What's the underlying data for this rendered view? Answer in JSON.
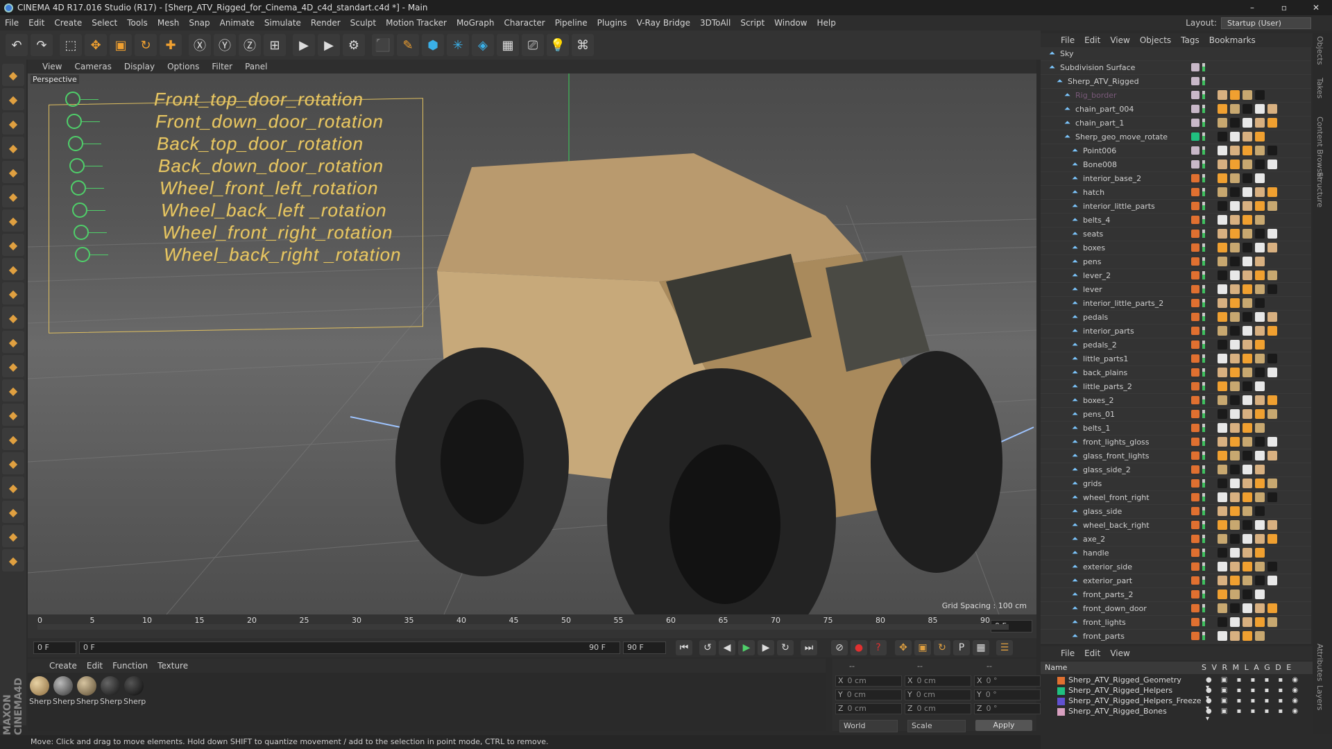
{
  "window": {
    "title": "CINEMA 4D R17.016 Studio (R17) - [Sherp_ATV_Rigged_for_Cinema_4D_c4d_standart.c4d *] - Main",
    "minimize": "–",
    "maximize": "▫",
    "close": "✕"
  },
  "menubar": [
    "File",
    "Edit",
    "Create",
    "Select",
    "Tools",
    "Mesh",
    "Snap",
    "Animate",
    "Simulate",
    "Render",
    "Sculpt",
    "Motion Tracker",
    "MoGraph",
    "Character",
    "Pipeline",
    "Plugins",
    "V-Ray Bridge",
    "3DToAll",
    "Script",
    "Window",
    "Help"
  ],
  "layout": {
    "label": "Layout:",
    "value": "Startup (User)"
  },
  "toolbar_icons": [
    "undo-icon",
    "redo-icon",
    "select-icon",
    "move-icon",
    "scale-icon",
    "rotate-icon",
    "live-select-icon",
    "x-axis-icon",
    "y-axis-icon",
    "z-axis-icon",
    "coord-system-icon",
    "render-view-icon",
    "render-picture-viewer-icon",
    "render-settings-icon",
    "cube-icon",
    "pen-icon",
    "subdivision-icon",
    "array-icon",
    "deformer-icon",
    "floor-icon",
    "camera-icon",
    "light-icon",
    "python-icon"
  ],
  "viewport": {
    "menu": [
      "View",
      "Cameras",
      "Display",
      "Options",
      "Filter",
      "Panel"
    ],
    "label": "Perspective",
    "grid_spacing": "Grid Spacing : 100 cm",
    "rig_controls": [
      "Front_top_door_rotation",
      "Front_down_door_rotation",
      "Back_top_door_rotation",
      "Back_down_door_rotation",
      "Wheel_front_left_rotation",
      "Wheel_back_left _rotation",
      "Wheel_front_right_rotation",
      "Wheel_back_right _rotation"
    ]
  },
  "timeline": {
    "ticks": [
      "0",
      "5",
      "10",
      "15",
      "20",
      "25",
      "30",
      "35",
      "40",
      "45",
      "50",
      "55",
      "60",
      "65",
      "70",
      "75",
      "80",
      "85",
      "90"
    ],
    "current_frame_end": "0 F",
    "start_field": "0 F",
    "range_start": "0 F",
    "range_end": "90 F",
    "end_field": "90 F"
  },
  "materials": {
    "menu": [
      "Create",
      "Edit",
      "Function",
      "Texture"
    ],
    "items": [
      "Sherp",
      "Sherp",
      "Sherp",
      "Sherp",
      "Sherp"
    ]
  },
  "coordinates": {
    "header_left": "--",
    "header_mid": "--",
    "header_right": "--",
    "rows": [
      {
        "a": "X",
        "av": "0 cm",
        "b": "X",
        "bv": "0 cm",
        "c": "X",
        "cv": "0 °"
      },
      {
        "a": "Y",
        "av": "0 cm",
        "b": "Y",
        "bv": "0 cm",
        "c": "Y",
        "cv": "0 °"
      },
      {
        "a": "Z",
        "av": "0 cm",
        "b": "Z",
        "bv": "0 cm",
        "c": "Z",
        "cv": "0 °"
      }
    ],
    "mode1": "World",
    "mode2": "Scale",
    "apply": "Apply"
  },
  "status": "Move: Click and drag to move elements. Hold down SHIFT to quantize movement / add to the selection in point mode, CTRL to remove.",
  "objects": {
    "menu": [
      "File",
      "Edit",
      "View",
      "Objects",
      "Tags",
      "Bookmarks"
    ],
    "items": [
      {
        "name": "Sky",
        "indent": 0
      },
      {
        "name": "Subdivision Surface",
        "indent": 0
      },
      {
        "name": "Sherp_ATV_Rigged",
        "indent": 1
      },
      {
        "name": "Rig_border",
        "indent": 2
      },
      {
        "name": "chain_part_004",
        "indent": 2
      },
      {
        "name": "chain_part_1",
        "indent": 2
      },
      {
        "name": "Sherp_geo_move_rotate",
        "indent": 2
      },
      {
        "name": "Point006",
        "indent": 3
      },
      {
        "name": "Bone008",
        "indent": 3
      },
      {
        "name": "interior_base_2",
        "indent": 3
      },
      {
        "name": "hatch",
        "indent": 3
      },
      {
        "name": "interior_little_parts",
        "indent": 3
      },
      {
        "name": "belts_4",
        "indent": 3
      },
      {
        "name": "seats",
        "indent": 3
      },
      {
        "name": "boxes",
        "indent": 3
      },
      {
        "name": "pens",
        "indent": 3
      },
      {
        "name": "lever_2",
        "indent": 3
      },
      {
        "name": "lever",
        "indent": 3
      },
      {
        "name": "interior_little_parts_2",
        "indent": 3
      },
      {
        "name": "pedals",
        "indent": 3
      },
      {
        "name": "interior_parts",
        "indent": 3
      },
      {
        "name": "pedals_2",
        "indent": 3
      },
      {
        "name": "little_parts1",
        "indent": 3
      },
      {
        "name": "back_plains",
        "indent": 3
      },
      {
        "name": "little_parts_2",
        "indent": 3
      },
      {
        "name": "boxes_2",
        "indent": 3
      },
      {
        "name": "pens_01",
        "indent": 3
      },
      {
        "name": "belts_1",
        "indent": 3
      },
      {
        "name": "front_lights_gloss",
        "indent": 3
      },
      {
        "name": "glass_front_lights",
        "indent": 3
      },
      {
        "name": "glass_side_2",
        "indent": 3
      },
      {
        "name": "grids",
        "indent": 3
      },
      {
        "name": "wheel_front_right",
        "indent": 3
      },
      {
        "name": "glass_side",
        "indent": 3
      },
      {
        "name": "wheel_back_right",
        "indent": 3
      },
      {
        "name": "axe_2",
        "indent": 3
      },
      {
        "name": "handle",
        "indent": 3
      },
      {
        "name": "exterior_side",
        "indent": 3
      },
      {
        "name": "exterior_part",
        "indent": 3
      },
      {
        "name": "front_parts_2",
        "indent": 3
      },
      {
        "name": "front_down_door",
        "indent": 3
      },
      {
        "name": "front_lights",
        "indent": 3
      },
      {
        "name": "front_parts",
        "indent": 3
      }
    ]
  },
  "side_tabs": [
    "Objects",
    "Takes",
    "Content Browser",
    "Structure",
    "Attributes",
    "Layers"
  ],
  "layers": {
    "menu": [
      "File",
      "Edit",
      "View"
    ],
    "header": {
      "name": "Name",
      "cols": "S V R M L A G D E"
    },
    "items": [
      {
        "name": "Sherp_ATV_Rigged_Geometry",
        "color": "#e07030"
      },
      {
        "name": "Sherp_ATV_Rigged_Helpers",
        "color": "#20c080"
      },
      {
        "name": "Sherp_ATV_Rigged_Helpers_Freeze",
        "color": "#6050d0"
      },
      {
        "name": "Sherp_ATV_Rigged_Bones",
        "color": "#d8a0c0"
      }
    ],
    "flags": "● ▣ ▪ ▪ ▪ ▪ ◉ ▾"
  }
}
